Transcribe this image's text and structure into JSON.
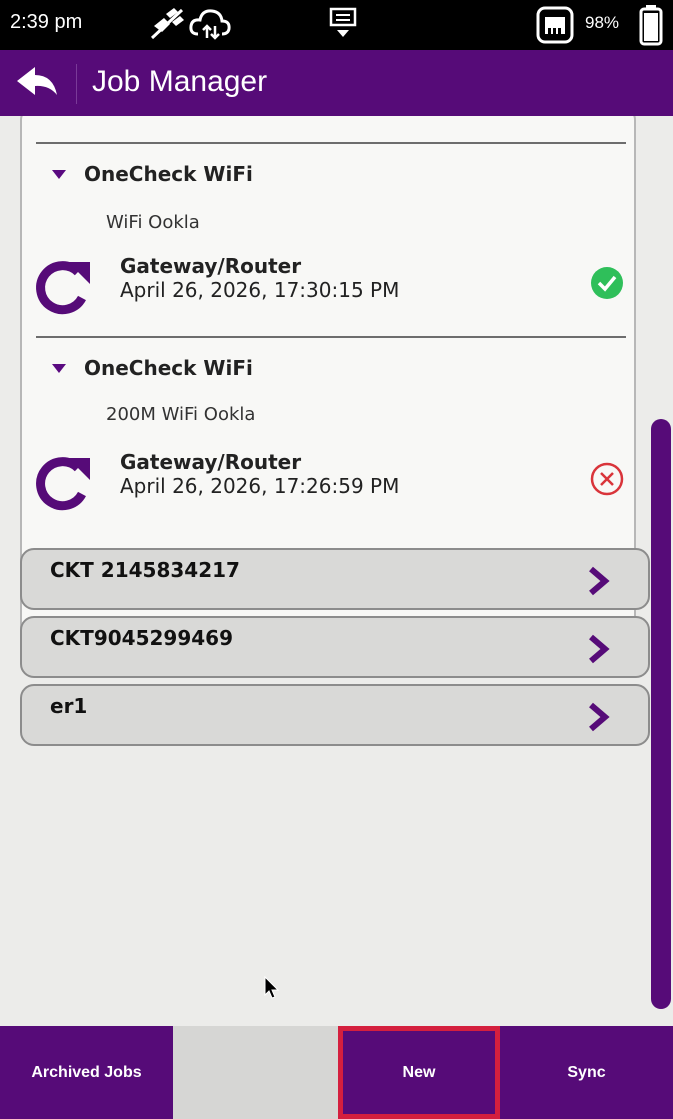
{
  "status_bar": {
    "time": "2:39 pm",
    "battery_percent": "98%",
    "icons": [
      "satellite-off-icon",
      "cloud-sync-icon",
      "keyboard-dock-icon",
      "ethernet-icon",
      "battery-icon"
    ]
  },
  "header": {
    "title": "Job Manager",
    "back_icon": "back-arrow-icon"
  },
  "expanded_job": {
    "tests": [
      {
        "name": "OneCheck WiFi",
        "subtitle": "WiFi Ookla",
        "result": {
          "device": "Gateway/Router",
          "timestamp": "April 26, 2026, 17:30:15 PM",
          "status": "pass"
        }
      },
      {
        "name": "OneCheck WiFi",
        "subtitle": "200M WiFi Ookla",
        "result": {
          "device": "Gateway/Router",
          "timestamp": "April 26, 2026, 17:26:59 PM",
          "status": "fail"
        }
      }
    ]
  },
  "jobs": [
    {
      "name": "CKT 2145834217"
    },
    {
      "name": "CKT9045299469"
    },
    {
      "name": "er1"
    }
  ],
  "bottom_nav": {
    "archived_label": "Archived Jobs",
    "new_label": "New",
    "sync_label": "Sync"
  },
  "colors": {
    "brand_purple": "#560b78",
    "pass_green": "#2fbf5a",
    "fail_red": "#d9343a",
    "highlight_red": "#d41f3e"
  }
}
